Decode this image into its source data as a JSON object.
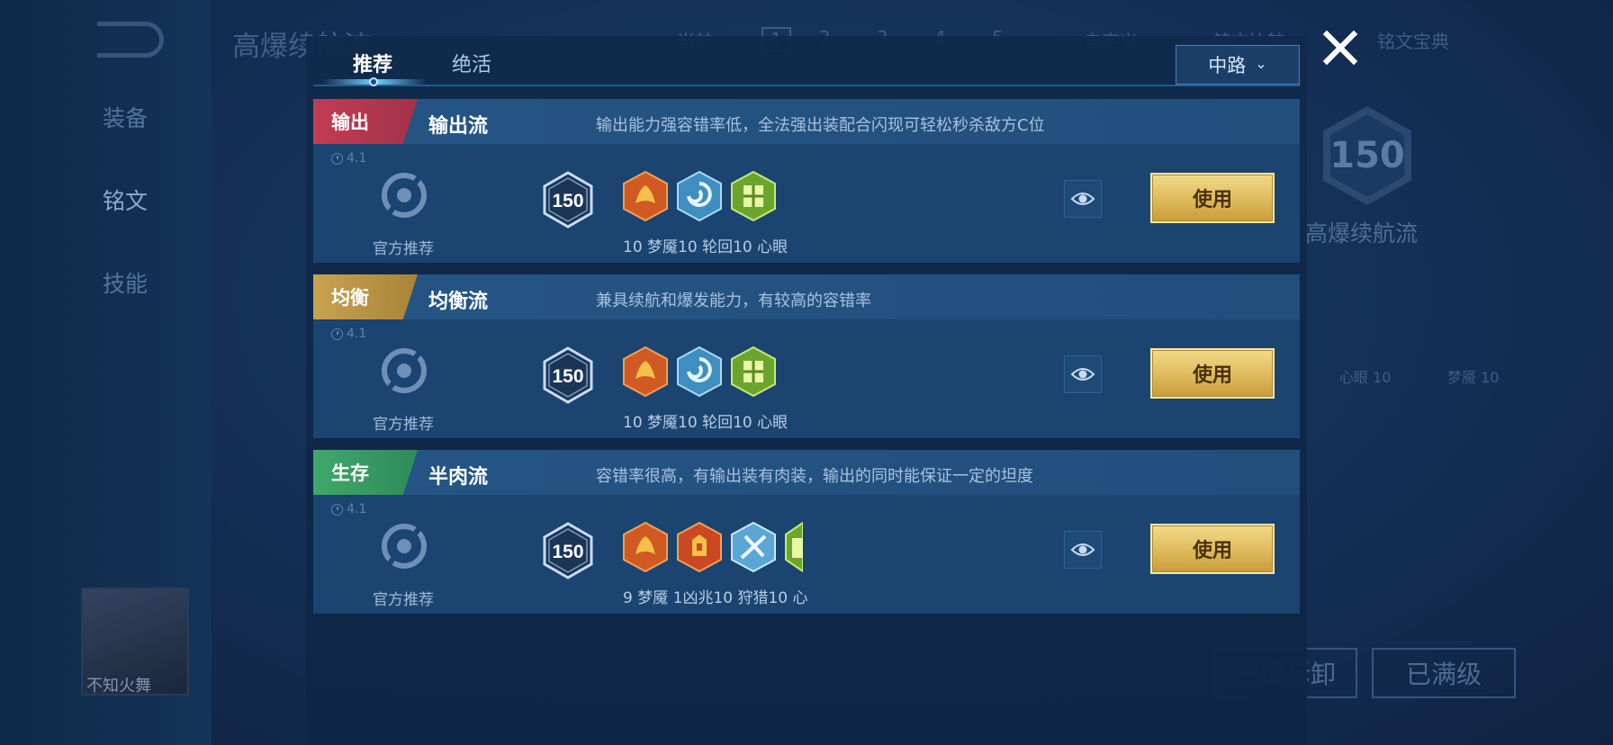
{
  "background": {
    "page_title": "高爆续航流",
    "nav": [
      "装备",
      "铭文",
      "技能"
    ],
    "pager_current": "当前",
    "pages": [
      "1",
      "2",
      "3",
      "4",
      "5"
    ],
    "custom": "自定义",
    "rune_guide": "铭文宝典",
    "rune_compare": "铭文比较",
    "right_level": "150",
    "right_name": "高爆续航流",
    "right_runes": [
      "心眼 10",
      "梦魇 10"
    ],
    "btn_dismantle": "一键拆卸",
    "btn_maxed": "已满级",
    "player_name": "不知火舞"
  },
  "modal": {
    "tabs": [
      {
        "label": "推荐",
        "active": true
      },
      {
        "label": "绝活",
        "active": false
      }
    ],
    "lane": {
      "label": "中路",
      "chevron": "chevron-down-icon"
    },
    "close_icon": "close-icon",
    "cards": [
      {
        "tag": "输出",
        "tag_color": "#c23d52",
        "name": "输出流",
        "desc": "输出能力强容错率低，全法强出装配合闪现可轻松秒杀敌方C位",
        "version": "4.1",
        "official": "官方推荐",
        "level": "150",
        "runes_label": "10 梦魇10 轮回10 心眼",
        "use": "使用"
      },
      {
        "tag": "均衡",
        "tag_color": "#c8a24e",
        "name": "均衡流",
        "desc": "兼具续航和爆发能力，有较高的容错率",
        "version": "4.1",
        "official": "官方推荐",
        "level": "150",
        "runes_label": "10 梦魇10 轮回10 心眼",
        "use": "使用"
      },
      {
        "tag": "生存",
        "tag_color": "#3fa86c",
        "name": "半肉流",
        "desc": "容错率很高，有输出装有肉装，输出的同时能保证一定的坦度",
        "version": "4.1",
        "official": "官方推荐",
        "level": "150",
        "runes_label": "9 梦魇  1凶兆10 狩猎10 心",
        "use": "使用"
      }
    ]
  }
}
